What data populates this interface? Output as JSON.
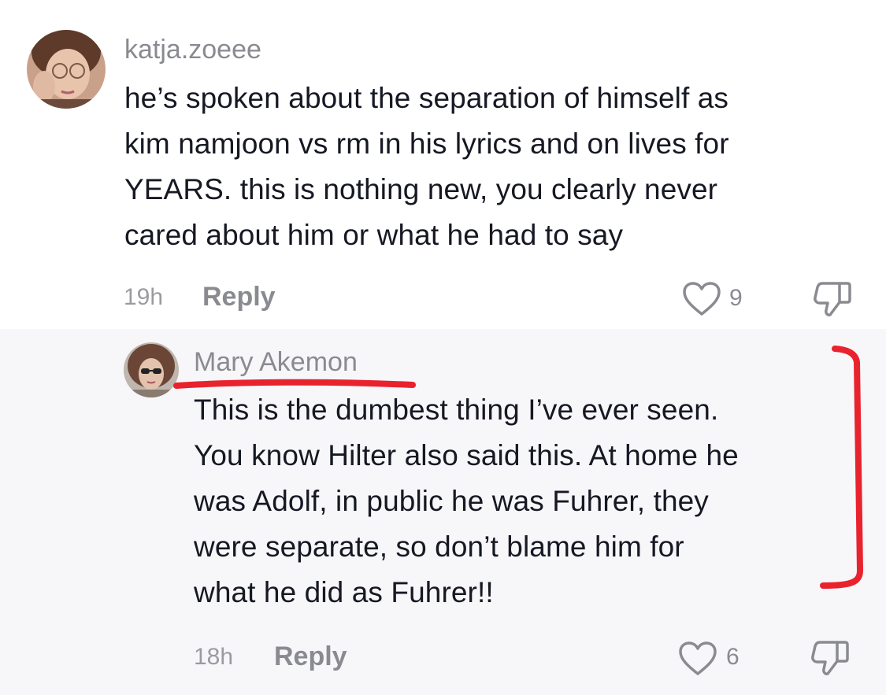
{
  "comments": [
    {
      "username": "katja.zoeee",
      "text": "he’s spoken about the separation of himself as\nkim namjoon vs rm in his lyrics and on lives for\nYEARS. this is nothing new, you clearly never\ncared about him or what he had to say",
      "time": "19h",
      "reply_label": "Reply",
      "likes": "9",
      "avatar_icon": "profile-photo",
      "like_icon": "heart-outline-icon",
      "dislike_icon": "thumbs-down-icon"
    }
  ],
  "replies": [
    {
      "username": "Mary Akemon",
      "text": "This is the dumbest thing I’ve ever seen.\nYou know Hilter also said this. At home he\nwas Adolf, in public he was Fuhrer, they\nwere separate, so don’t blame him for\nwhat he did as Fuhrer!!",
      "time": "18h",
      "reply_label": "Reply",
      "likes": "6",
      "avatar_icon": "profile-photo",
      "like_icon": "heart-outline-icon",
      "dislike_icon": "thumbs-down-icon"
    }
  ],
  "colors": {
    "username": "#8a8b91",
    "body_text": "#161823",
    "reply_background": "#f7f7f9",
    "annotation_red": "#e8232e"
  }
}
